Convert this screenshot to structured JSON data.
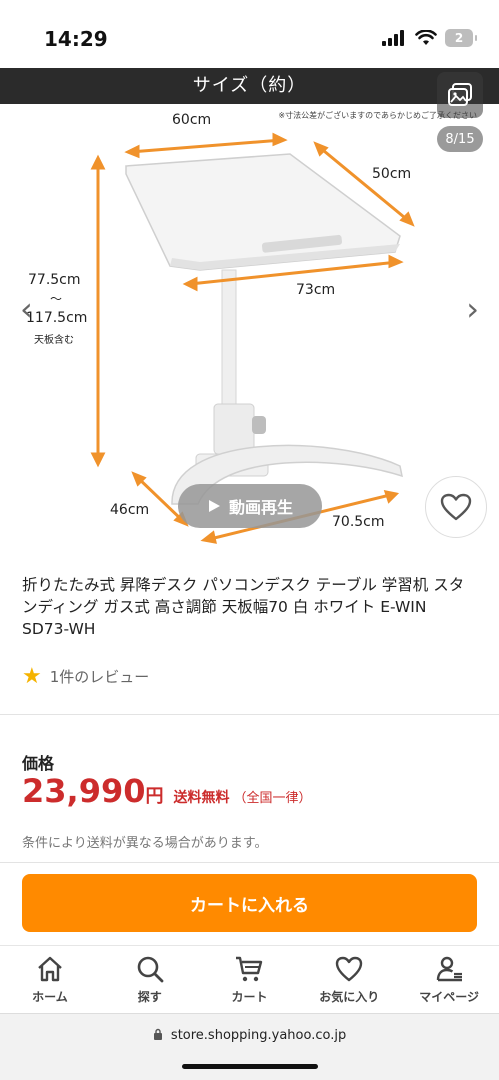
{
  "status": {
    "time": "14:29",
    "battery": "2"
  },
  "image": {
    "band_title": "サイズ（約）",
    "note": "※寸法公差がございますのであらかじめご了承ください",
    "counter": "8/15",
    "dims": {
      "top_width": "60cm",
      "top_depth": "50cm",
      "height_min": "77.5cm",
      "height_sep": "〜",
      "height_max": "117.5cm",
      "height_note": "天板含む",
      "mid_width": "73cm",
      "base_depth": "46cm",
      "base_width": "70.5cm"
    },
    "video_label": "動画再生"
  },
  "product": {
    "title": "折りたたみ式 昇降デスク パソコンデスク テーブル 学習机 スタンディング ガス式 高さ調節 天板幅70 白 ホワイト E-WIN SD73-WH",
    "review_text": "1件のレビュー"
  },
  "price": {
    "label": "価格",
    "amount": "23,990",
    "unit": "円",
    "shipping": "送料無料",
    "shipping_sub": "（全国一律）",
    "condition": "条件により送料が異なる場合があります。"
  },
  "cart_button": "カートに入れる",
  "nav": [
    {
      "label": "ホーム",
      "icon": "home-icon"
    },
    {
      "label": "探す",
      "icon": "search-icon"
    },
    {
      "label": "カート",
      "icon": "cart-icon"
    },
    {
      "label": "お気に入り",
      "icon": "heart-icon"
    },
    {
      "label": "マイページ",
      "icon": "person-icon"
    }
  ],
  "url": "store.shopping.yahoo.co.jp",
  "colors": {
    "accent": "#ff8a00",
    "price": "#cc2c2c",
    "dimension": "#f0922b"
  }
}
